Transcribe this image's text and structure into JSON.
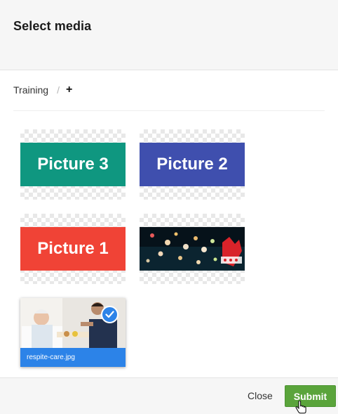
{
  "header": {
    "title": "Select media"
  },
  "breadcrumb": {
    "items": [
      "Training"
    ],
    "separator": "/",
    "add_label": "+"
  },
  "media": [
    {
      "label": "Picture 3",
      "color": "#0f9780"
    },
    {
      "label": "Picture 2",
      "color": "#3f4fae"
    },
    {
      "label": "Picture 1",
      "color": "#f04336"
    },
    {
      "icon": "dark-water-photo"
    },
    {
      "filename": "respite-care.jpg",
      "selected": true,
      "icon": "checkmark-icon"
    }
  ],
  "footer": {
    "close_label": "Close",
    "submit_label": "Submit",
    "submit_color": "#5aa43b"
  }
}
